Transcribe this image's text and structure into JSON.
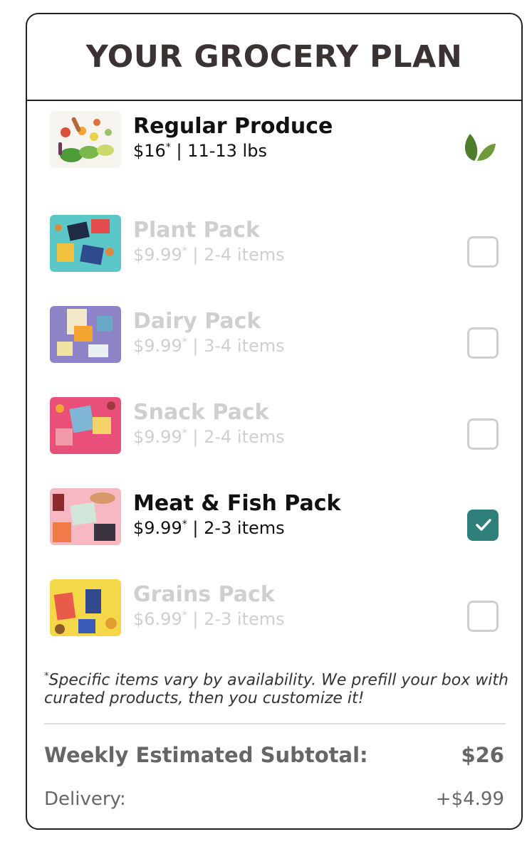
{
  "plan": {
    "title": "YOUR GROCERY PLAN",
    "items": [
      {
        "name": "Regular Produce",
        "price": "$16",
        "asterisk": "*",
        "qty": "| 11-13 lbs",
        "state": "included",
        "icon": "leaf-icon"
      },
      {
        "name": "Plant Pack",
        "price": "$9.99",
        "asterisk": "*",
        "qty": "| 2-4 items",
        "state": "unchecked"
      },
      {
        "name": "Dairy Pack",
        "price": "$9.99",
        "asterisk": "*",
        "qty": "| 3-4 items",
        "state": "unchecked"
      },
      {
        "name": "Snack Pack",
        "price": "$9.99",
        "asterisk": "*",
        "qty": "| 2-4 items",
        "state": "unchecked"
      },
      {
        "name": "Meat & Fish Pack",
        "price": "$9.99",
        "asterisk": "*",
        "qty": "| 2-3 items",
        "state": "checked"
      },
      {
        "name": "Grains Pack",
        "price": "$6.99",
        "asterisk": "*",
        "qty": "| 2-3 items",
        "state": "unchecked"
      }
    ],
    "footnote": {
      "asterisk": "*",
      "text": "Specific items vary by availability. We prefill your box with curated products, then you customize it!"
    },
    "subtotal": {
      "label": "Weekly Estimated Subtotal:",
      "value": "$26"
    },
    "delivery": {
      "label": "Delivery:",
      "value": "+$4.99"
    },
    "colors": {
      "accent": "#2f7f7a",
      "leaf": "#4e7d2b",
      "title": "#3a3331",
      "muted": "#cfcfcf"
    }
  }
}
